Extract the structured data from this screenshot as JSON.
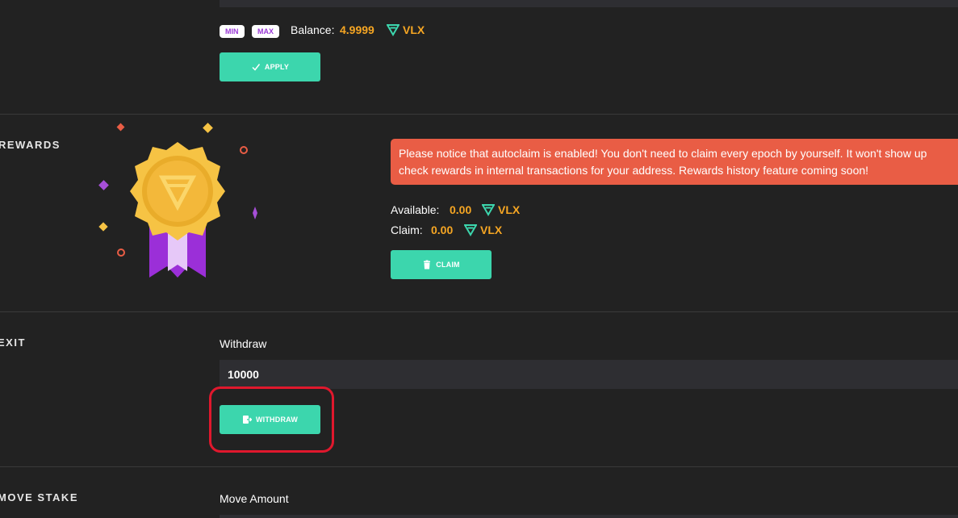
{
  "stake": {
    "min_label": "MIN",
    "max_label": "MAX",
    "balance_label": "Balance:",
    "balance_value": "4.9999",
    "currency": "VLX",
    "apply_label": "APPLY"
  },
  "rewards": {
    "title": "REWARDS",
    "notice_line1": "Please notice that autoclaim is enabled! You don't need to claim every epoch by yourself. It won't show up",
    "notice_line2": "check rewards in internal transactions for your address. Rewards history feature coming soon!",
    "available_label": "Available:",
    "available_value": "0.00",
    "claim_label": "Claim:",
    "claim_value": "0.00",
    "currency": "VLX",
    "claim_button": "CLAIM"
  },
  "exit": {
    "title": "EXIT",
    "withdraw_label": "Withdraw",
    "withdraw_value": "10000",
    "withdraw_button": "WITHDRAW"
  },
  "move_stake": {
    "title": "MOVE STAKE",
    "move_amount_label": "Move Amount"
  },
  "colors": {
    "background": "#222222",
    "accent": "#3cd6ad",
    "orange": "#f6a623",
    "notice": "#e95d45",
    "highlight": "#e0182d"
  },
  "icons": [
    "check-icon",
    "vlx-logo-icon",
    "trash-icon",
    "exit-door-icon",
    "medal-badge-icon"
  ]
}
